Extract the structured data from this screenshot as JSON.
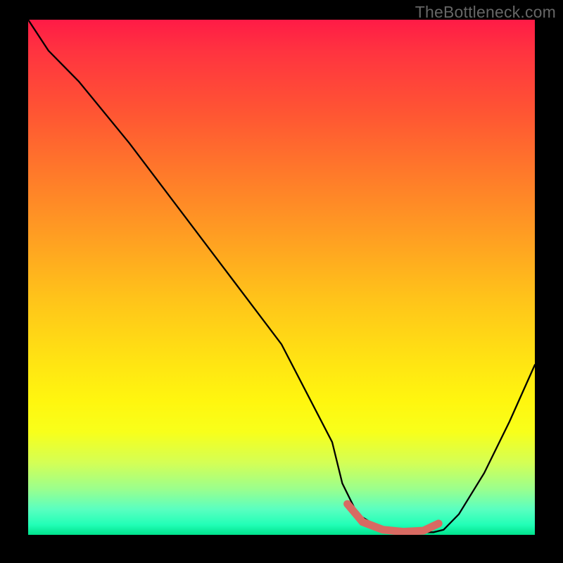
{
  "watermark": "TheBottleneck.com",
  "chart_data": {
    "type": "line",
    "title": "",
    "xlabel": "",
    "ylabel": "",
    "xlim": [
      0,
      100
    ],
    "ylim": [
      0,
      100
    ],
    "series": [
      {
        "name": "curve",
        "x": [
          0,
          4,
          10,
          20,
          30,
          40,
          50,
          60,
          62,
          65,
          70,
          75,
          80,
          82,
          85,
          90,
          95,
          100
        ],
        "y": [
          100,
          94,
          88,
          76,
          63,
          50,
          37,
          18,
          10,
          4,
          1,
          0.5,
          0.5,
          1,
          4,
          12,
          22,
          33
        ]
      },
      {
        "name": "highlight-segment",
        "x": [
          63,
          66,
          70,
          74,
          78,
          81
        ],
        "y": [
          6,
          2.5,
          1,
          0.6,
          0.8,
          2.2
        ]
      }
    ],
    "gradient_stops": [
      {
        "pos": 0,
        "color": "#ff1b46"
      },
      {
        "pos": 50,
        "color": "#ffc31a"
      },
      {
        "pos": 80,
        "color": "#f8ff1a"
      },
      {
        "pos": 100,
        "color": "#00e28c"
      }
    ],
    "highlight_color": "#d86a62"
  }
}
